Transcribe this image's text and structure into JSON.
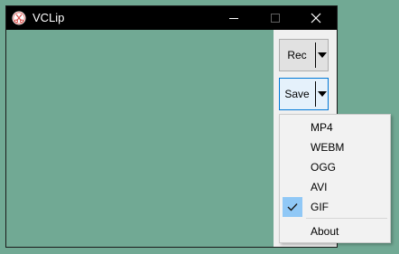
{
  "window": {
    "title": "VCLip",
    "app_icon": "scissors-icon",
    "controls": [
      "minimize-icon",
      "maximize-icon",
      "close-icon"
    ]
  },
  "toolbar": {
    "rec_label": "Rec",
    "save_label": "Save",
    "dropdown_icon": "triangle-down-icon"
  },
  "save_menu": {
    "items": [
      {
        "label": "MP4",
        "checked": false
      },
      {
        "label": "WEBM",
        "checked": false
      },
      {
        "label": "OGG",
        "checked": false
      },
      {
        "label": "AVI",
        "checked": false
      },
      {
        "label": "GIF",
        "checked": true
      },
      {
        "label": "About",
        "checked": false
      }
    ]
  },
  "colors": {
    "desktop": "#71a994",
    "titlebar": "#000000",
    "check_highlight": "#90c8f6",
    "focus_border": "#0078d7"
  }
}
